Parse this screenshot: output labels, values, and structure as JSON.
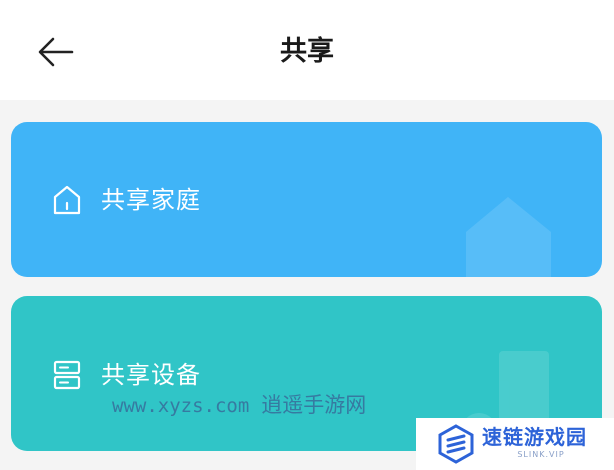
{
  "header": {
    "title": "共享",
    "back_icon": "arrow-left-icon"
  },
  "cards": [
    {
      "label": "共享家庭",
      "icon": "home-icon",
      "color": "#40b4f7"
    },
    {
      "label": "共享设备",
      "icon": "device-icon",
      "color": "#30c5c7"
    }
  ],
  "watermark": {
    "url": "www.xyzs.com",
    "name": "逍遥手游网"
  },
  "badge": {
    "name": "速链游戏园",
    "sub": "SLINK.VIP",
    "color": "#2d63d8"
  }
}
